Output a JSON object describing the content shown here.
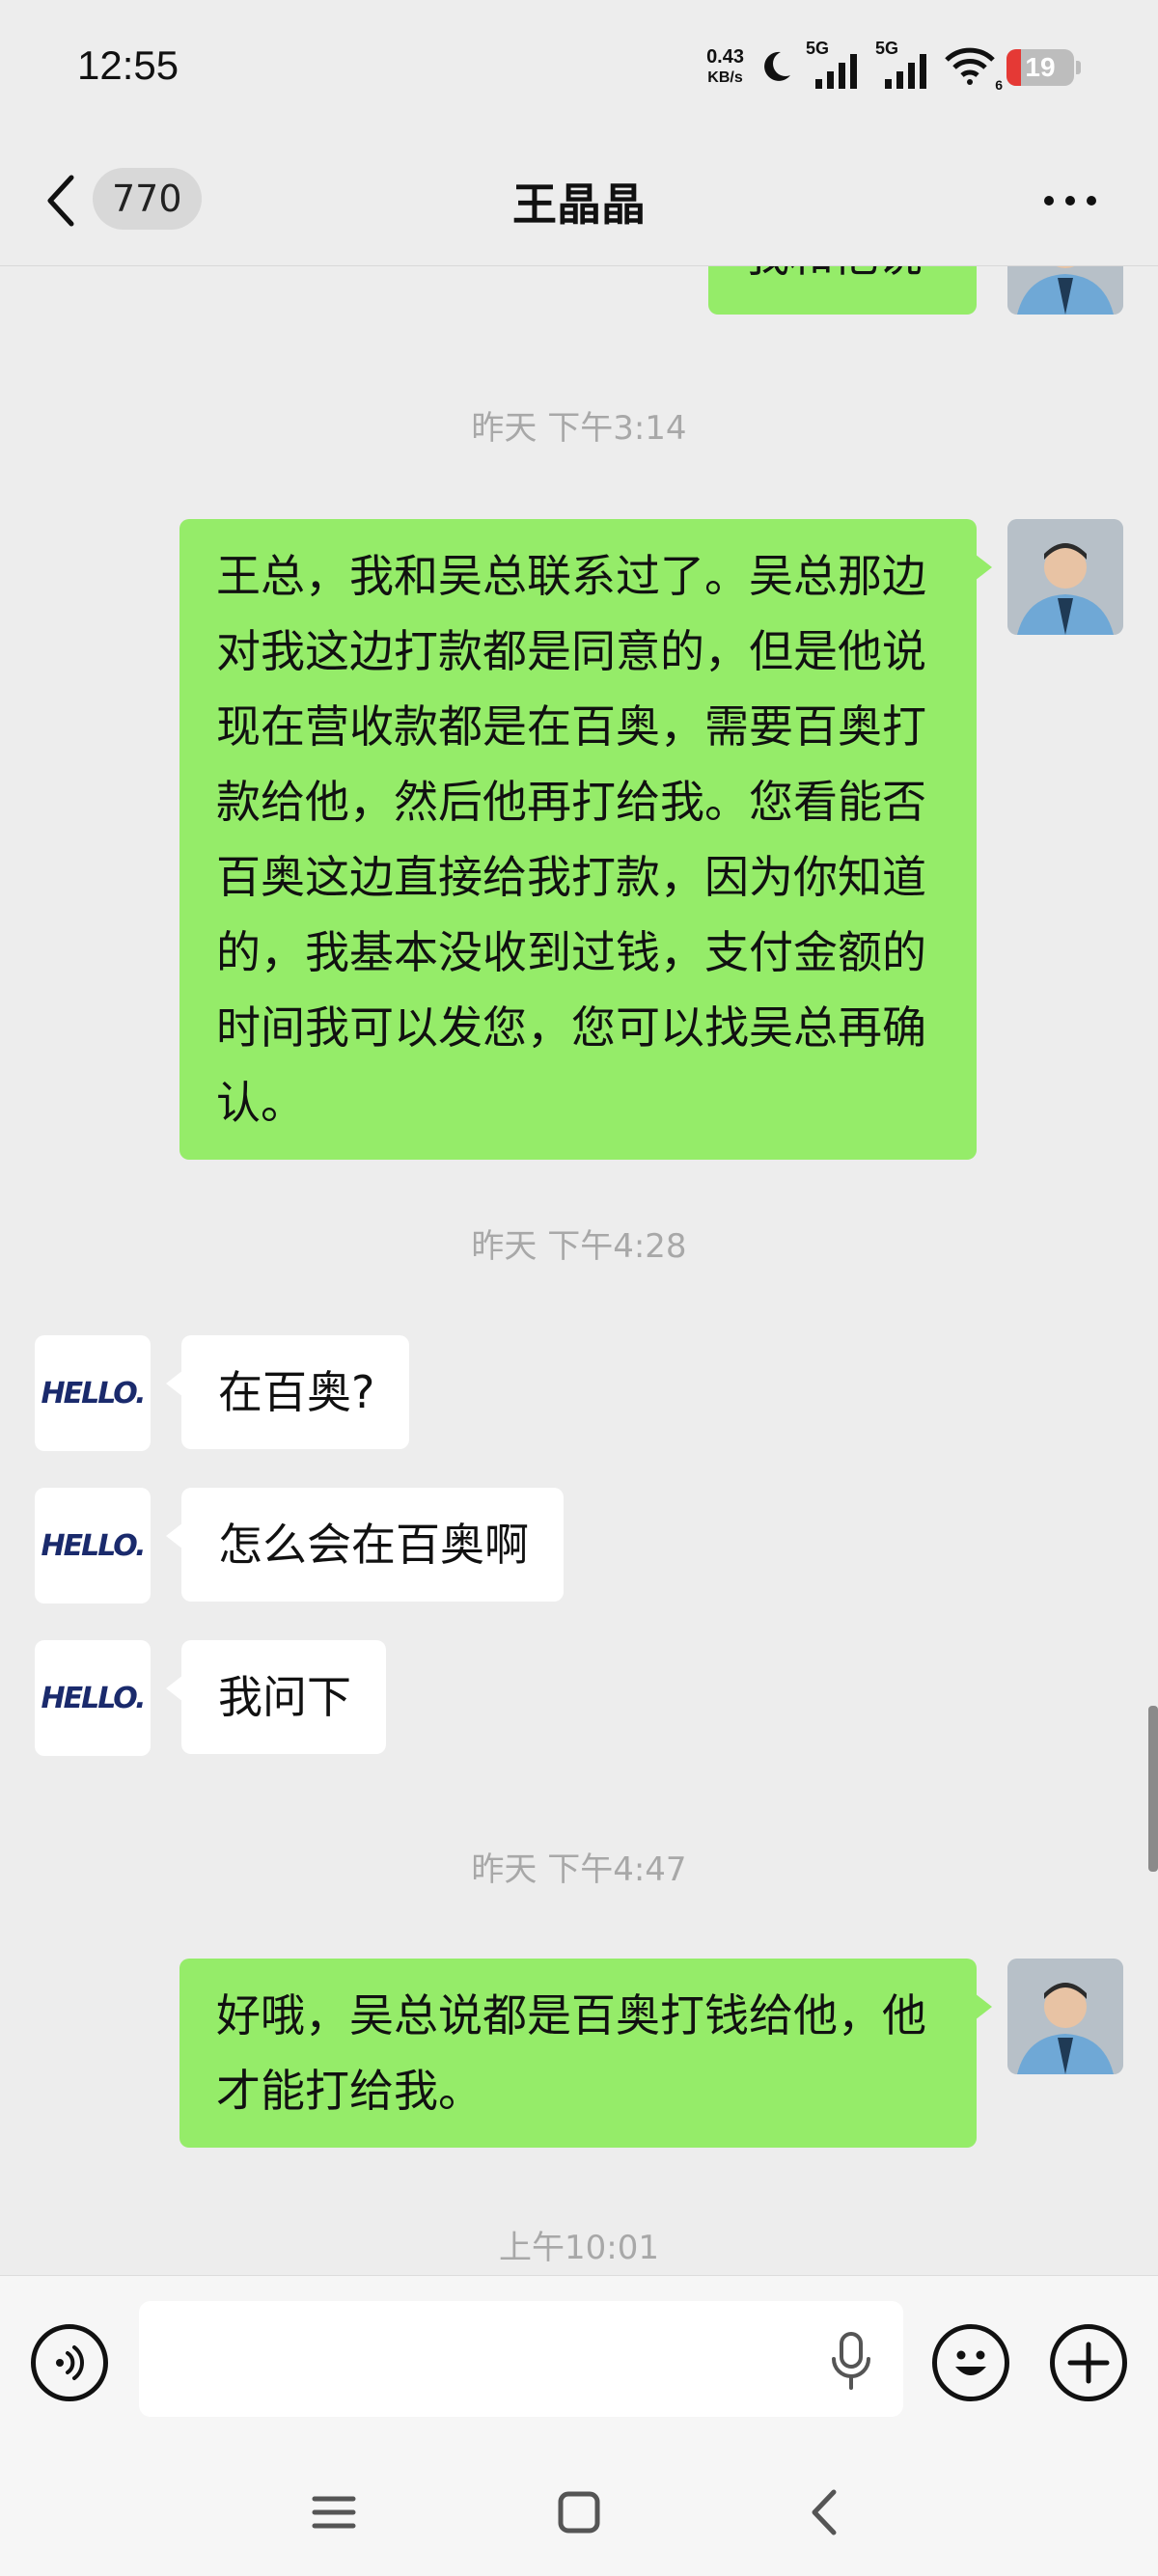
{
  "status_bar": {
    "time": "12:55",
    "net_speed_value": "0.43",
    "net_speed_unit": "KB/s",
    "signal_1_label": "5G",
    "signal_2_label": "5G",
    "wifi_sub": "6",
    "battery_level": "19",
    "battery_color": "#e53935"
  },
  "header": {
    "unread_count": "770",
    "title": "王晶晶"
  },
  "messages": [
    {
      "type": "timestamp",
      "text": "昨天 下午3:14"
    },
    {
      "type": "sent",
      "text": "王总，我和吴总联系过了。吴总那边对我这边打款都是同意的，但是他说现在营收款都是在百奥，需要百奥打款给他，然后他再打给我。您看能否百奥这边直接给我打款，因为你知道的，我基本没收到过钱，支付金额的时间我可以发您，您可以找吴总再确认。"
    },
    {
      "type": "timestamp",
      "text": "昨天 下午4:28"
    },
    {
      "type": "received",
      "text": "在百奥?"
    },
    {
      "type": "received",
      "text": "怎么会在百奥啊"
    },
    {
      "type": "received",
      "text": "我问下"
    },
    {
      "type": "timestamp",
      "text": "昨天 下午4:47"
    },
    {
      "type": "sent",
      "text": "好哦，吴总说都是百奥打钱给他，他才能打给我。"
    },
    {
      "type": "timestamp",
      "text": "上午10:01"
    }
  ],
  "partial_top_message": "我和他说",
  "other_avatar_logo": "HELLO.",
  "input": {
    "placeholder": "",
    "value": ""
  },
  "icons": {
    "back": "chevron-left-icon",
    "more": "more-dots-icon",
    "voice": "voice-mode-icon",
    "mic": "microphone-icon",
    "emoji": "emoji-icon",
    "add": "plus-icon",
    "menu": "menu-icon",
    "home": "home-square-icon",
    "sys_back": "back-triangle-icon"
  },
  "colors": {
    "sent_bubble": "#95ec69",
    "received_bubble": "#ffffff",
    "background": "#ededed"
  }
}
